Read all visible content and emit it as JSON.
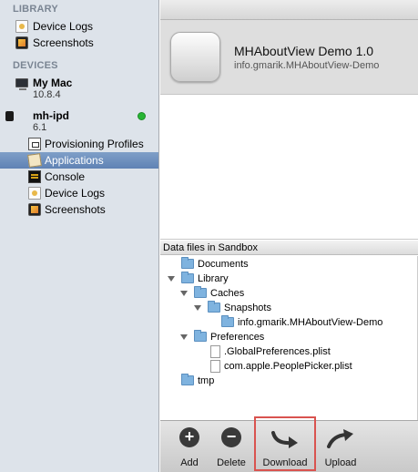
{
  "sidebar": {
    "library_header": "LIBRARY",
    "library_items": [
      {
        "label": "Device Logs",
        "icon": "device-logs-icon"
      },
      {
        "label": "Screenshots",
        "icon": "screenshots-icon"
      }
    ],
    "devices_header": "DEVICES",
    "mac": {
      "name": "My Mac",
      "version": "10.8.4",
      "icon": "mac-icon"
    },
    "device": {
      "name": "mh-ipd",
      "version": "6.1",
      "icon": "ipad-icon",
      "status_color": "#27b534"
    },
    "device_items": [
      {
        "label": "Provisioning Profiles",
        "icon": "provisioning-icon"
      },
      {
        "label": "Applications",
        "icon": "applications-icon",
        "selected": true
      },
      {
        "label": "Console",
        "icon": "console-icon"
      },
      {
        "label": "Device Logs",
        "icon": "device-logs-icon"
      },
      {
        "label": "Screenshots",
        "icon": "screenshots-icon"
      }
    ]
  },
  "app": {
    "name": "MHAboutView Demo 1.0",
    "bundle_id": "info.gmarik.MHAboutView-Demo"
  },
  "sandbox": {
    "header": "Data files in Sandbox",
    "tree": [
      {
        "label": "Documents",
        "type": "folder",
        "depth": 0,
        "expanded": false
      },
      {
        "label": "Library",
        "type": "folder",
        "depth": 0,
        "expanded": true
      },
      {
        "label": "Caches",
        "type": "folder",
        "depth": 1,
        "expanded": true
      },
      {
        "label": "Snapshots",
        "type": "folder",
        "depth": 2,
        "expanded": true
      },
      {
        "label": "info.gmarik.MHAboutView-Demo",
        "type": "folder",
        "depth": 3,
        "expanded": false
      },
      {
        "label": "Preferences",
        "type": "folder",
        "depth": 1,
        "expanded": true
      },
      {
        "label": ".GlobalPreferences.plist",
        "type": "file",
        "depth": 2
      },
      {
        "label": "com.apple.PeoplePicker.plist",
        "type": "file",
        "depth": 2
      },
      {
        "label": "tmp",
        "type": "folder",
        "depth": 0,
        "expanded": false
      }
    ]
  },
  "toolbar": {
    "add_label": "Add",
    "delete_label": "Delete",
    "download_label": "Download",
    "upload_label": "Upload",
    "highlight_color": "#d9534f"
  }
}
